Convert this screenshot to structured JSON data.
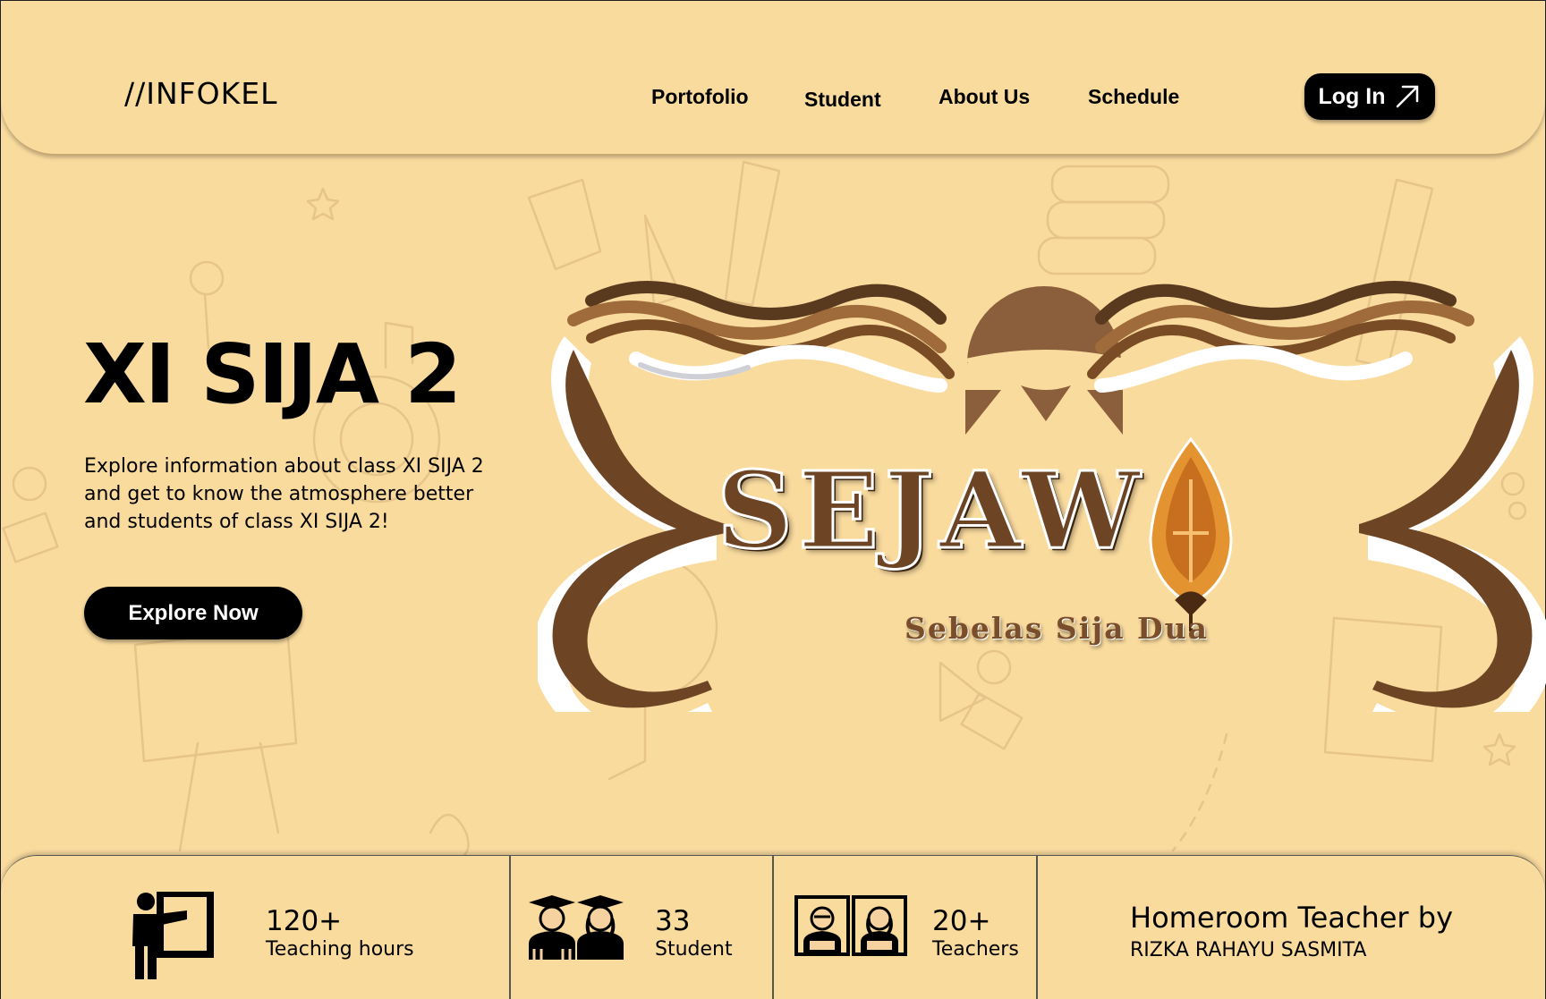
{
  "header": {
    "logo": "//INFOKEL",
    "nav": [
      "Portofolio",
      "Student",
      "About Us",
      "Schedule"
    ],
    "login_label": "Log In"
  },
  "hero": {
    "title": "XI SIJA 2",
    "description": "Explore information about class XI SIJA 2 and get to know the atmosphere better and students of class XI SIJA 2!",
    "cta_label": "Explore Now"
  },
  "emblem": {
    "word": "SEJAW",
    "tagline": "Sebelas Sija Dua"
  },
  "stats": [
    {
      "icon": "teacher-board-icon",
      "value": "120+",
      "label": "Teaching hours"
    },
    {
      "icon": "graduates-icon",
      "value": "33",
      "label": "Student"
    },
    {
      "icon": "teachers-icon",
      "value": "20+",
      "label": "Teachers"
    }
  ],
  "homeroom": {
    "heading": "Homeroom Teacher by",
    "name": "RIZKA RAHAYU SASMITA"
  },
  "colors": {
    "background": "#FADB9E",
    "brown_dark": "#6E4524",
    "brown_light": "#9C6A3C",
    "accent_orange": "#E3932F",
    "button": "#000000"
  }
}
